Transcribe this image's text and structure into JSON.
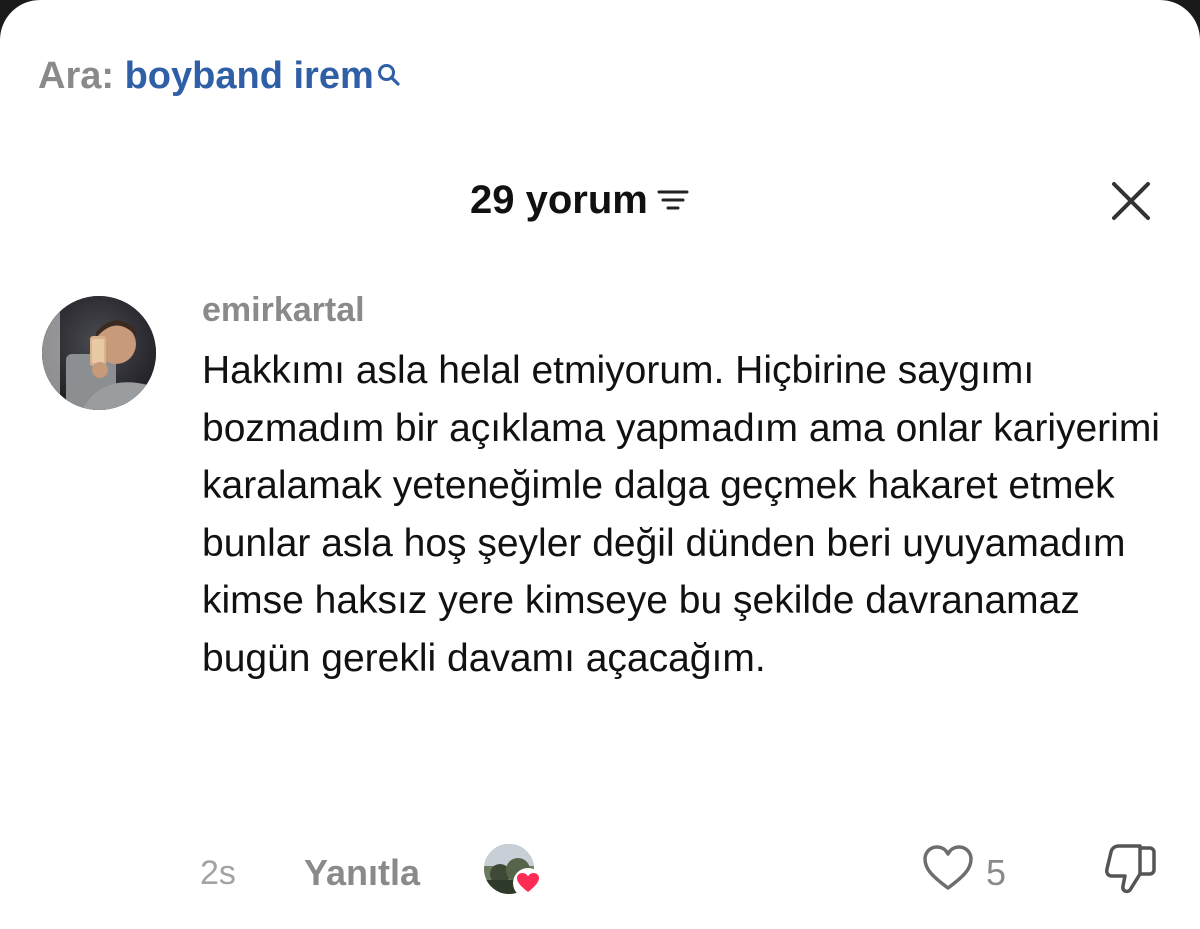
{
  "search": {
    "prefix": "Ara:",
    "query": "boyband irem",
    "icon": "search-icon"
  },
  "header": {
    "comment_count": "29 yorum",
    "filter_icon": "filter-icon",
    "close_icon": "close-icon"
  },
  "comment": {
    "username": "emirkartal",
    "text": "Hakkımı asla helal etmiyorum. Hiçbirine saygımı bozmadım bir açıklama yapmadım ama onlar kariyerimi karalamak yeteneğimle dalga geçmek hakaret etmek bunlar asla hoş şeyler değil dünden beri uyuyamadım kimse haksız yere kimseye bu şekilde davranamaz bugün gerekli davamı açacağım.",
    "time_ago": "2s",
    "reply_label": "Yanıtla",
    "like_count": "5",
    "liked_by_creator": true
  },
  "colors": {
    "search_term": "#2f5fa6",
    "muted_text": "#8a8a8a",
    "primary_text": "#111111",
    "heart": "#fe2c55"
  }
}
